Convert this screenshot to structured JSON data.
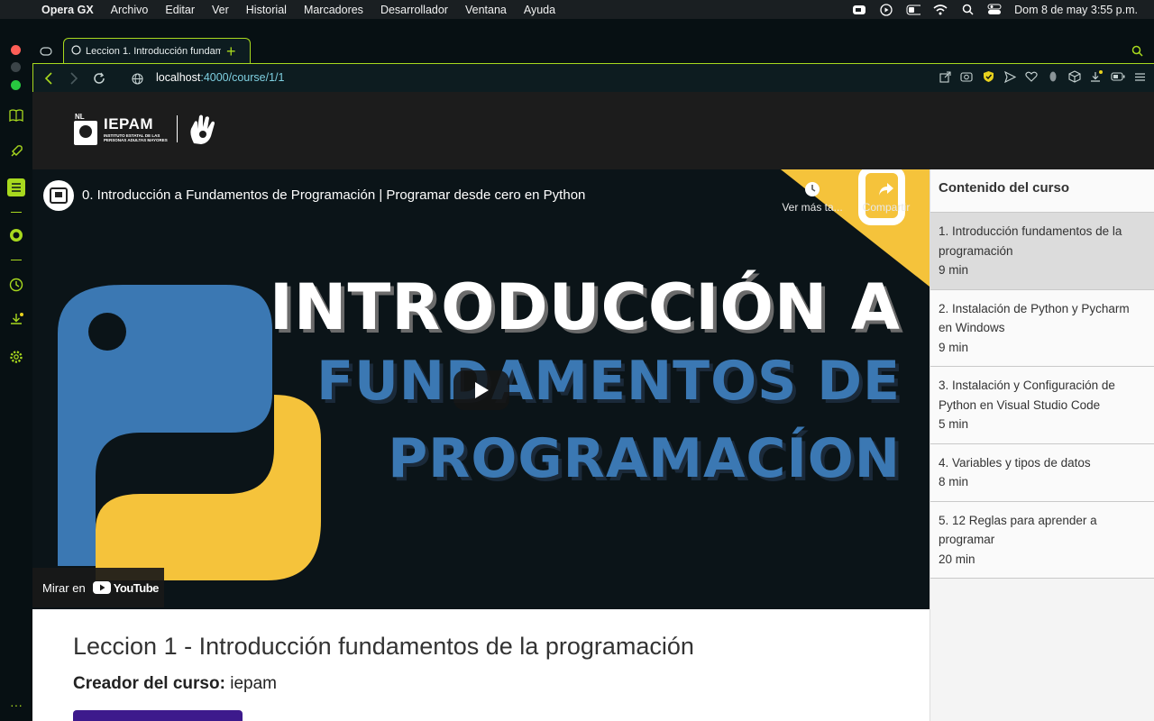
{
  "menubar": {
    "app": "Opera GX",
    "items": [
      "Archivo",
      "Editar",
      "Ver",
      "Historial",
      "Marcadores",
      "Desarrollador",
      "Ventana",
      "Ayuda"
    ],
    "datetime": "Dom 8 de may  3:55 p.m."
  },
  "browser": {
    "tab_title": "Leccion 1. Introducción fundam",
    "url_host": "localhost",
    "url_path": ":4000/course/1/1",
    "accent": "#a8d91e"
  },
  "site": {
    "logo_prefix": "NL",
    "logo_name": "IEPAM",
    "logo_sub_1": "INSTITUTO ESTATAL DE LAS",
    "logo_sub_2": "PERSONAS ADULTAS MAYORES"
  },
  "video": {
    "title": "0. Introducción a Fundamentos de Programación | Programar desde cero en Python",
    "watch_later": "Ver más ta...",
    "share": "Compartir",
    "thumb_line1": "INTRODUCCIÓN A",
    "thumb_line2": "FUNDAMENTOS DE",
    "thumb_line3": "PROGRAMACÍON",
    "watch_on": "Mirar en",
    "youtube": "YouTube"
  },
  "course": {
    "panel_title": "Contenido del curso",
    "lessons": [
      {
        "title": "1. Introducción fundamentos de la programación",
        "duration": "9 min"
      },
      {
        "title": "2. Instalación de Python y Pycharm en Windows",
        "duration": "9 min"
      },
      {
        "title": "3. Instalación y Configuración de Python en Visual Studio Code",
        "duration": "5 min"
      },
      {
        "title": "4. Variables y tipos de datos",
        "duration": "8 min"
      },
      {
        "title": "5. 12 Reglas para aprender a programar",
        "duration": "20 min"
      }
    ]
  },
  "lesson": {
    "title": "Leccion 1 - Introducción fundamentos de la programación",
    "creator_label": "Creador del curso:",
    "creator_value": "iepam"
  }
}
